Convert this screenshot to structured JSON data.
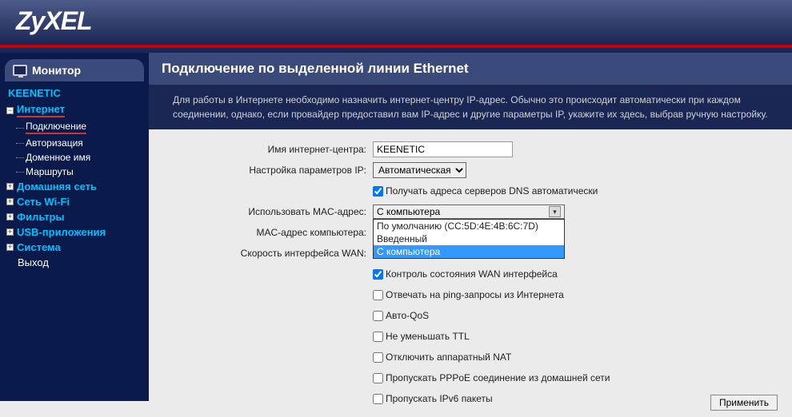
{
  "brand": "ZyXEL",
  "sidebar": {
    "monitor": "Монитор",
    "device": "KEENETIC",
    "internet": "Интернет",
    "sub": {
      "connection": "Подключение",
      "auth": "Авторизация",
      "domain": "Доменное имя",
      "routes": "Маршруты"
    },
    "home": "Домашняя сеть",
    "wifi": "Сеть Wi-Fi",
    "filters": "Фильтры",
    "usb": "USB-приложения",
    "system": "Система",
    "exit": "Выход"
  },
  "page": {
    "title": "Подключение по выделенной линии Ethernet",
    "desc": "Для работы в Интернете необходимо назначить интернет-центру IP-адрес. Обычно это происходит автоматически при каждом соединении, однако, если провайдер предоставил вам IP-адрес и другие параметры IP, укажите их здесь, выбрав ручную настройку."
  },
  "form": {
    "name_label": "Имя интернет-центра:",
    "name_value": "KEENETIC",
    "ip_label": "Настройка параметров IP:",
    "ip_value": "Автоматическая",
    "dns_auto": "Получать адреса серверов DNS автоматически",
    "mac_label": "Использовать MAC-адрес:",
    "mac_value": "С компьютера",
    "mac_options": {
      "default": "По умолчанию (CC:5D:4E:4B:6C:7D)",
      "entered": "Введенный",
      "computer": "С компьютера"
    },
    "mac_pc_label": "MAC-адрес компьютера:",
    "wan_speed_label": "Скорость интерфейса WAN:",
    "wan_control": "Контроль состояния WAN интерфейса",
    "ping": "Отвечать на ping-запросы из Интернета",
    "autoqos": "Авто-QoS",
    "ttl": "Не уменьшать TTL",
    "nat": "Отключить аппаратный NAT",
    "pppoe": "Пропускать PPPoE соединение из домашней сети",
    "ipv6": "Пропускать IPv6 пакеты",
    "apply": "Применить"
  }
}
